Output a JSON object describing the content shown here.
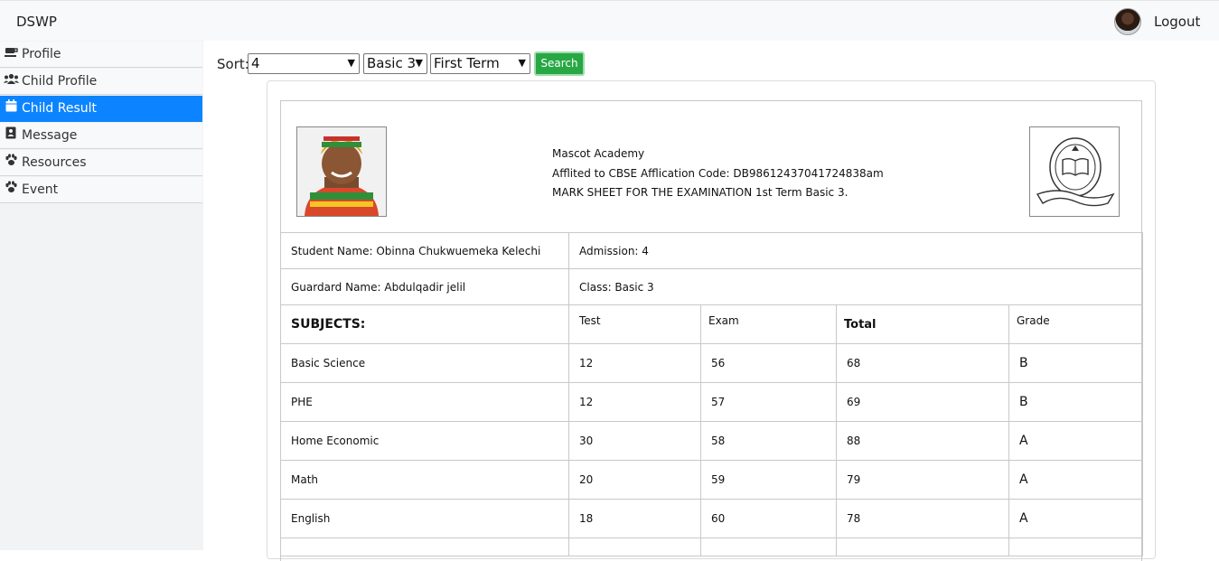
{
  "navbar": {
    "brand": "DSWP",
    "logout": "Logout"
  },
  "sidebar": {
    "items": [
      {
        "label": "Profile",
        "icon": "coffee-icon"
      },
      {
        "label": "Child Profile",
        "icon": "users-icon"
      },
      {
        "label": "Child Result",
        "icon": "calendar-icon",
        "active": true
      },
      {
        "label": "Message",
        "icon": "contact-book-icon"
      },
      {
        "label": "Resources",
        "icon": "paw-icon"
      },
      {
        "label": "Event",
        "icon": "paw-icon"
      }
    ]
  },
  "sort": {
    "label": "Sort:",
    "admission_value": "4",
    "class_value": "Basic 3",
    "term_value": "First Term",
    "search_label": "Search"
  },
  "sheet": {
    "school_name": "Mascot Academy",
    "affiliation": "Afflited to CBSE Afflication Code: DB98612437041724838am",
    "title": "MARK SHEET FOR THE EXAMINATION 1st Term Basic 3.",
    "student_name": "Student Name: Obinna Chukwuemeka Kelechi",
    "admission": "Admission: 4",
    "guardian_name": "Guardard Name: Abdulqadir jelil",
    "class": "Class: Basic 3"
  },
  "results": {
    "headers": {
      "subjects": "SUBJECTS:",
      "test": "Test",
      "exam": "Exam",
      "total": "Total",
      "grade": "Grade"
    },
    "rows": [
      {
        "subject": "Basic Science",
        "test": "12",
        "exam": "56",
        "total": "68",
        "grade": "B"
      },
      {
        "subject": "PHE",
        "test": "12",
        "exam": "57",
        "total": "69",
        "grade": "B"
      },
      {
        "subject": "Home Economic",
        "test": "30",
        "exam": "58",
        "total": "88",
        "grade": "A"
      },
      {
        "subject": "Math",
        "test": "20",
        "exam": "59",
        "total": "79",
        "grade": "A"
      },
      {
        "subject": "English",
        "test": "18",
        "exam": "60",
        "total": "78",
        "grade": "A"
      }
    ]
  },
  "colors": {
    "active": "#0d84ff",
    "search": "#28a745"
  }
}
